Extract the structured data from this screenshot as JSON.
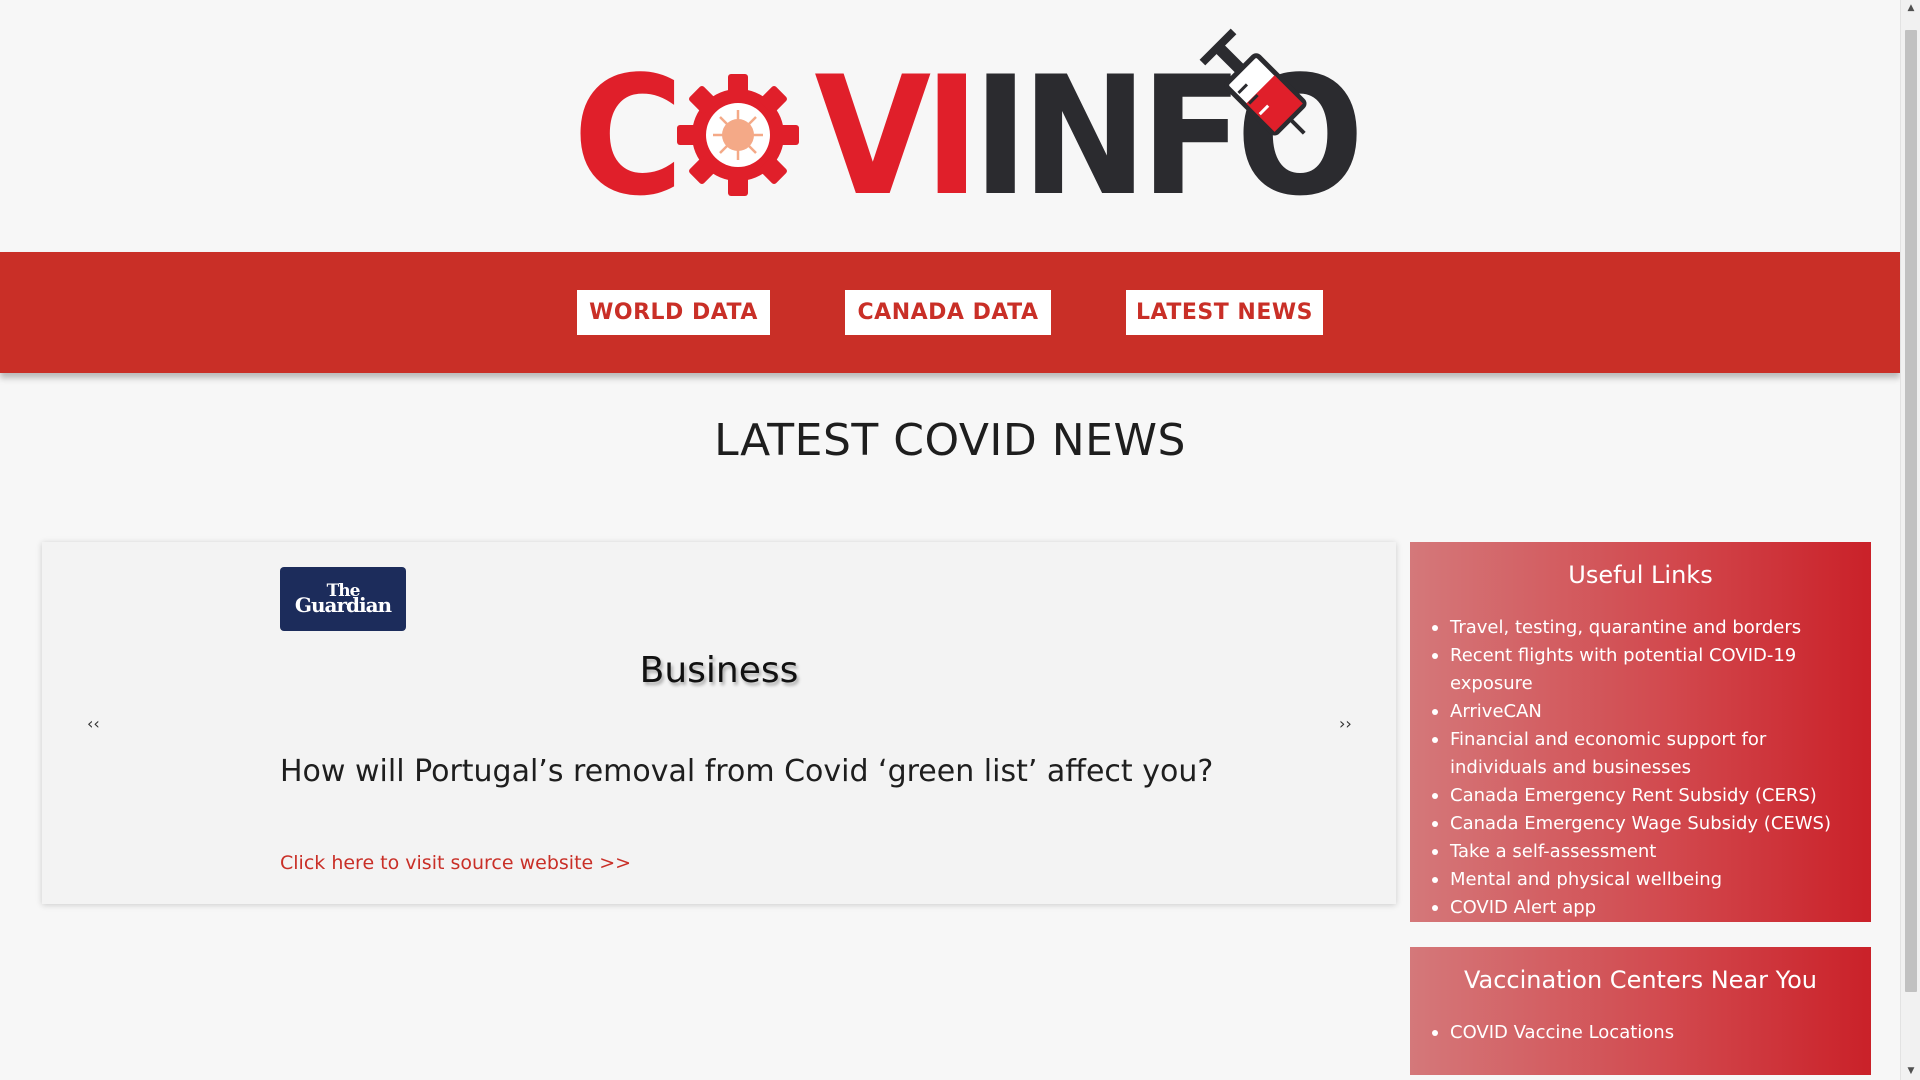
{
  "logo": {
    "part_red": "C",
    "part_red2": "VI",
    "part_dark": "INFO",
    "colors": {
      "red": "#e01f2a",
      "dark": "#2b2b2f",
      "gear_inner": "#f4a987"
    }
  },
  "nav": {
    "items": [
      {
        "label": "WORLD DATA"
      },
      {
        "label": "CANADA DATA"
      },
      {
        "label": "LATEST NEWS"
      }
    ],
    "color": "#c92f27"
  },
  "page": {
    "title": "LATEST COVID NEWS"
  },
  "news_card": {
    "source_logo": {
      "line1": "The",
      "line2": "Guardian"
    },
    "category": "Business",
    "prev_icon": "‹‹",
    "next_icon": "››",
    "headline": "How will Portugal’s removal from Covid ‘green list’ affect you?",
    "link_text": "Click here to visit source website >>"
  },
  "useful_links": {
    "title": "Useful Links",
    "items": [
      {
        "label": "Travel, testing, quarantine and borders"
      },
      {
        "label": "Recent flights with potential COVID-19 exposure"
      },
      {
        "label": "ArriveCAN"
      },
      {
        "label": "Financial and economic support for individuals and businesses"
      },
      {
        "label": "Canada Emergency Rent Subsidy (CERS)"
      },
      {
        "label": "Canada Emergency Wage Subsidy (CEWS)"
      },
      {
        "label": "Take a self-assessment"
      },
      {
        "label": "Mental and physical wellbeing"
      },
      {
        "label": "COVID Alert app"
      }
    ]
  },
  "vaccination": {
    "title": "Vaccination Centers Near You",
    "items": [
      {
        "label": "COVID Vaccine Locations"
      }
    ]
  },
  "scrollbar": {
    "up_icon": "▲",
    "down_icon": "▼"
  }
}
